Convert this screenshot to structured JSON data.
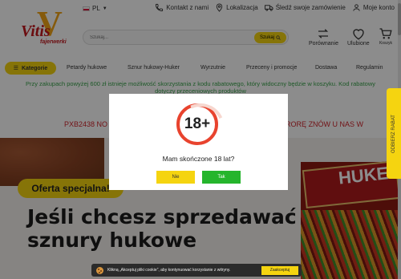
{
  "header": {
    "language": "PL",
    "links": [
      {
        "label": "Kontakt z nami",
        "icon": "phone-icon"
      },
      {
        "label": "Lokalizacja",
        "icon": "location-pin-icon"
      },
      {
        "label": "Śledź swoje zamówienie",
        "icon": "truck-icon"
      },
      {
        "label": "Moje konto",
        "icon": "user-icon"
      }
    ],
    "logo": {
      "letter": "V",
      "name": "Vitis",
      "sub": "fajerwerki"
    },
    "search": {
      "placeholder": "Szukaj...",
      "button": "Szukaj"
    },
    "actions": {
      "compare": "Porównanie",
      "wishlist": "Ulubione",
      "cart": "Koszyk"
    }
  },
  "nav": {
    "categories_label": "Kategorie",
    "items": [
      "Petardy hukowe",
      "Sznur hukowy-Huker",
      "Wyrzutnie",
      "Przeceny i promocje",
      "Dostawa",
      "Regulamin"
    ]
  },
  "promo": {
    "line1": "Przy zakupach powyżej 600 zł istnieje możliwość skorzystania z kodu rabatowego, który widoczny będzie w koszyku. Kod rabatowy",
    "line2": "dotyczy przeceniowych produktów",
    "code_left": "PXB2438 NO",
    "code_right": "I FURORĘ ZNÓW U NAS W"
  },
  "hero": {
    "special": "Oferta specjalna!",
    "title_line1": "Jeśli chcesz sprzedawać",
    "title_line2": "sznury hukowe",
    "crate_text": "HUKE"
  },
  "side_tab": "ODBIERZ RABAT",
  "age_modal": {
    "badge": "18+",
    "question": "Mam skończone 18 lat?",
    "no": "Nie",
    "yes": "Tak"
  },
  "cookie": {
    "text": "Klikną „Akceptuj pliki cookie”, aby kontynuować korzystanie z witryny.",
    "button": "Zaakceptuj"
  },
  "colors": {
    "accent": "#f5d410",
    "brand_red": "#c4161c",
    "promo_green": "#3aa34c",
    "yes_green": "#25b52c"
  }
}
